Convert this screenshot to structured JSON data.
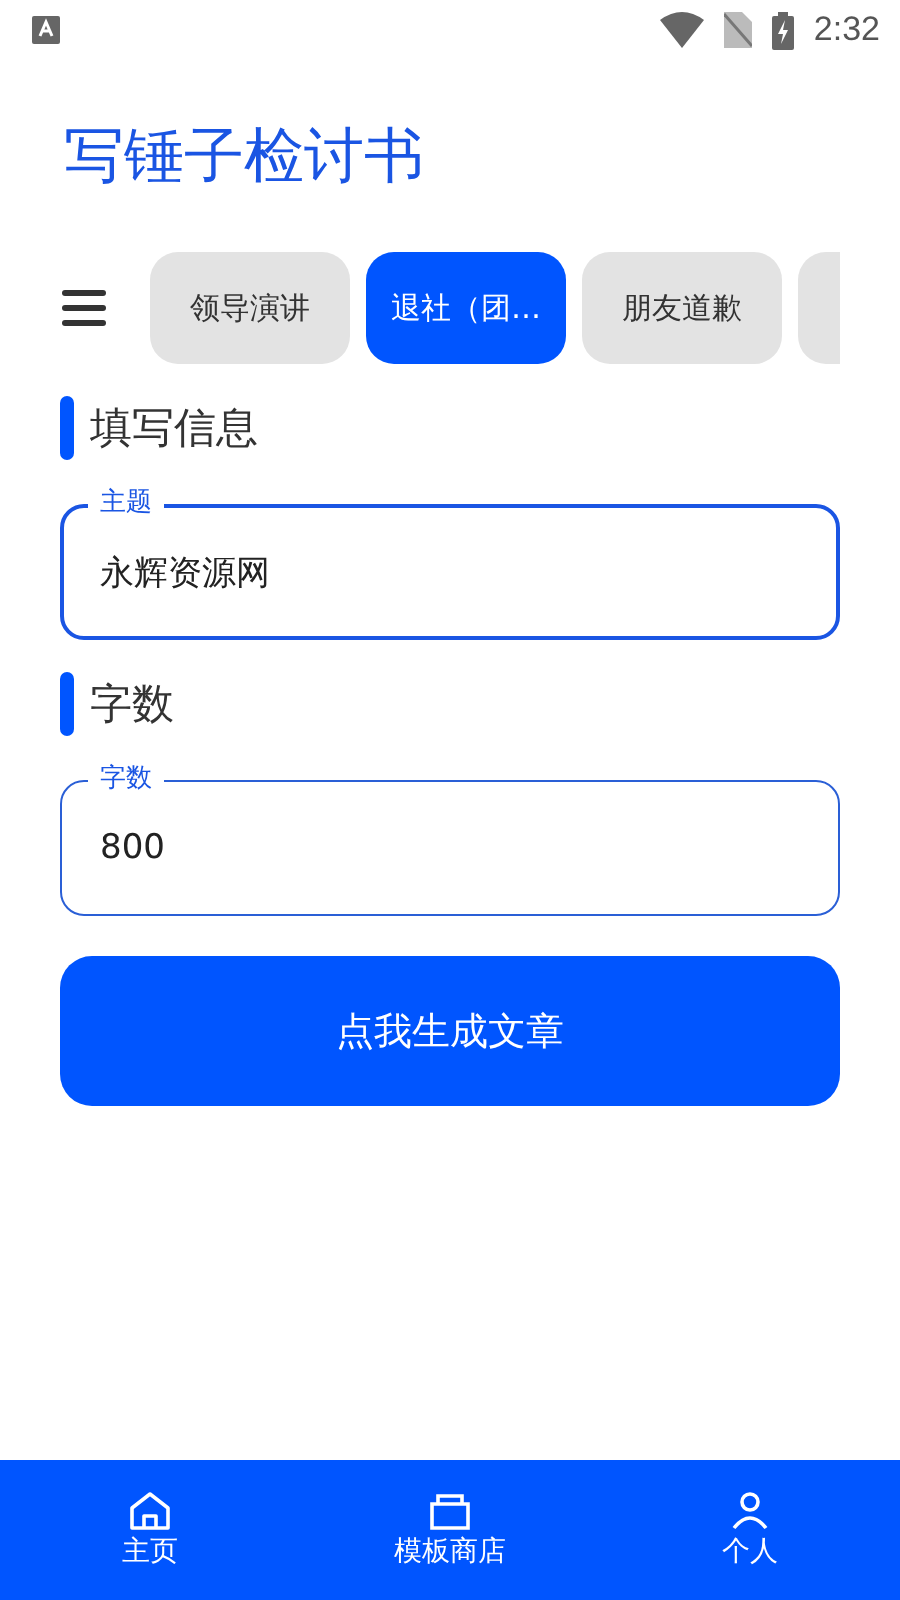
{
  "status_bar": {
    "time": "2:32"
  },
  "app_title": "写锤子检讨书",
  "tabs": [
    {
      "label": "领导演讲",
      "selected": false
    },
    {
      "label": "退社（团…",
      "selected": true
    },
    {
      "label": "朋友道歉",
      "selected": false
    }
  ],
  "sections": [
    {
      "heading": "填写信息",
      "field": {
        "label": "主题",
        "value": "永辉资源网",
        "focused": true
      }
    },
    {
      "heading": "字数",
      "field": {
        "label": "字数",
        "value": "800",
        "focused": false
      }
    }
  ],
  "generate_button": "点我生成文章",
  "bottom_nav": [
    {
      "label": "主页",
      "kind": "home"
    },
    {
      "label": "模板商店",
      "kind": "store"
    },
    {
      "label": "个人",
      "kind": "person"
    }
  ]
}
